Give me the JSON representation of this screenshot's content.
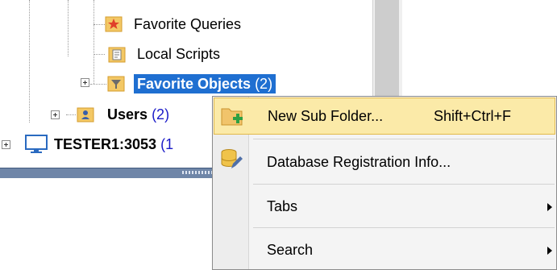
{
  "tree": {
    "favorite_queries": "Favorite Queries",
    "local_scripts": "Local Scripts",
    "favorite_objects": "Favorite Objects",
    "favorite_objects_count": "(2)",
    "users": "Users",
    "users_count": "(2)",
    "server": "TESTER1:3053",
    "server_count_partial": "(1"
  },
  "menu": {
    "new_sub_folder": "New Sub Folder...",
    "new_sub_folder_shortcut": "Shift+Ctrl+F",
    "db_registration_info": "Database Registration Info...",
    "tabs": "Tabs",
    "search": "Search"
  },
  "icons": {
    "favorite_queries": "star-icon",
    "local_scripts": "script-icon",
    "favorite_objects": "filter-icon",
    "users": "users-folder-icon",
    "server": "monitor-icon",
    "new_sub_folder": "new-folder-icon",
    "db_registration_info": "database-edit-icon"
  },
  "colors": {
    "selection": "#1f6fd1",
    "count": "#1a1ac8",
    "menu_highlight": "#fbeaa8"
  }
}
